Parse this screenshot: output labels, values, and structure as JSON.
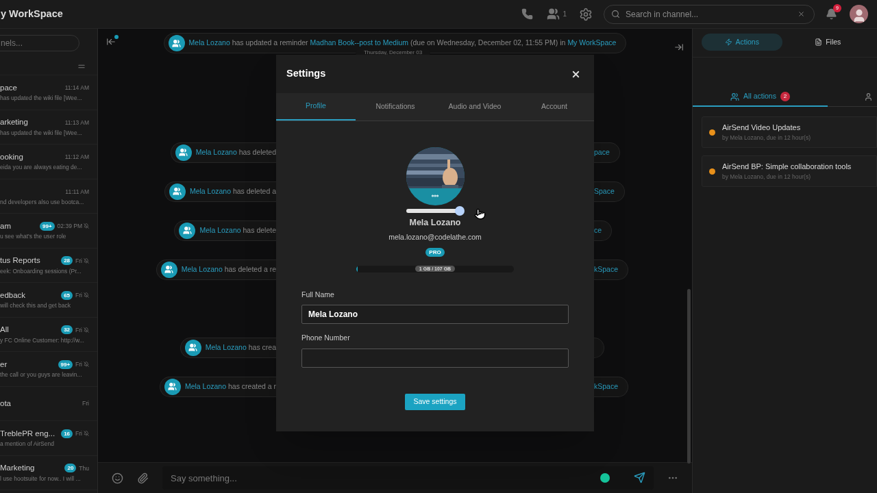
{
  "workspace": {
    "title": "y WorkSpace"
  },
  "topbar": {
    "member_count": "1",
    "search": {
      "placeholder": "Search in channel..."
    },
    "notification_count": "9"
  },
  "sidebar": {
    "search": {
      "placeholder": "nels..."
    },
    "channels": [
      {
        "name": "pace",
        "time": "11:14 AM",
        "preview": "has updated the wiki file [Wee...",
        "muted": false
      },
      {
        "name": "arketing",
        "time": "11:13 AM",
        "preview": "has updated the wiki file [Wee...",
        "muted": false
      },
      {
        "name": "ooking",
        "time": "11:12 AM",
        "preview": "eida you are always eating de...",
        "muted": false
      },
      {
        "time": "11:11 AM",
        "preview": "nd developers also use bootca...",
        "muted": false
      },
      {
        "name": "am",
        "badge": "99+",
        "time": "02:39 PM",
        "preview": "u see what's the user role",
        "muted": true
      },
      {
        "name": "tus Reports",
        "badge": "28",
        "time": "Fri",
        "preview": "eek: Onboarding sessions (Pr...",
        "muted": true
      },
      {
        "name": "edback",
        "badge": "65",
        "time": "Fri",
        "preview": "will check this and get back",
        "muted": true
      },
      {
        "name": "All",
        "badge": "32",
        "time": "Fri",
        "preview": "y FC Online Customer: http://w...",
        "muted": true
      },
      {
        "name": "er",
        "badge": "99+",
        "time": "Fri",
        "preview": "the call or you guys are leavin...",
        "muted": true
      },
      {
        "name": "ota",
        "time": "Fri",
        "muted": false
      },
      {
        "name": "TreblePR eng...",
        "badge": "16",
        "time": "Fri",
        "preview": "a mention of AirSend",
        "muted": true
      },
      {
        "name": "Marketing",
        "badge": "20",
        "time": "Thu",
        "preview": "l use hootsuite for now.. I will ...",
        "muted": false
      }
    ]
  },
  "chat": {
    "top_event": [
      {
        "kind": "link",
        "text": "Mela Lozano"
      },
      {
        "kind": "text",
        "text": "has updated a reminder"
      },
      {
        "kind": "link",
        "text": "Madhan Book--post to Medium"
      },
      {
        "kind": "text",
        "text": "(due on Wednesday, December 02, 11:55 PM) in"
      },
      {
        "kind": "link",
        "text": "My WorkSpace"
      }
    ],
    "date_label": "Thursday, December 03",
    "events": [
      {
        "name": "Mela Lozano",
        "text": "has deleted",
        "tail": "pace"
      },
      {
        "name": "Mela Lozano",
        "text": "has deleted a",
        "tail": "Space"
      },
      {
        "name": "Mela Lozano",
        "text": "has delete",
        "tail": "ce"
      },
      {
        "name": "Mela Lozano",
        "text": "has deleted a re",
        "tail": "kSpace"
      },
      {
        "name": "Mela Lozano",
        "text": "has crea"
      },
      {
        "name": "Mela Lozano",
        "text": "has created a r",
        "tail": "kSpace"
      }
    ],
    "composer": {
      "placeholder": "Say something..."
    }
  },
  "settings": {
    "title": "Settings",
    "tabs": [
      {
        "label": "Profile",
        "selected": true
      },
      {
        "label": "Notifications",
        "selected": false
      },
      {
        "label": "Audio and Video",
        "selected": false
      },
      {
        "label": "Account",
        "selected": false
      }
    ],
    "zoom": {
      "level": 0.93
    },
    "name": "Mela Lozano",
    "email": "mela.lozano@codelathe.com",
    "plan": "PRO",
    "storage": {
      "level": 0.01,
      "label": "1 GB / 107 GB"
    },
    "fields": [
      {
        "label": "Full Name",
        "value": "Mela Lozano"
      },
      {
        "label": "Phone Number"
      }
    ],
    "save_button": "Save settings"
  },
  "actions_panel": {
    "tabs": [
      {
        "label": "Actions",
        "selected": true
      },
      {
        "label": "Files",
        "selected": false
      }
    ],
    "filters": [
      {
        "label": "All actions",
        "count": "2",
        "selected": true
      },
      {
        "selected": false
      }
    ],
    "items": [
      {
        "title": "AirSend Video Updates",
        "subtitle": "by Mela Lozano, due in 12 hour(s)",
        "color": "#e8901a"
      },
      {
        "title": "AirSend BP: Simple collaboration tools",
        "subtitle": "by Mela Lozano, due in 12 hour(s)",
        "color": "#e8901a"
      }
    ]
  }
}
